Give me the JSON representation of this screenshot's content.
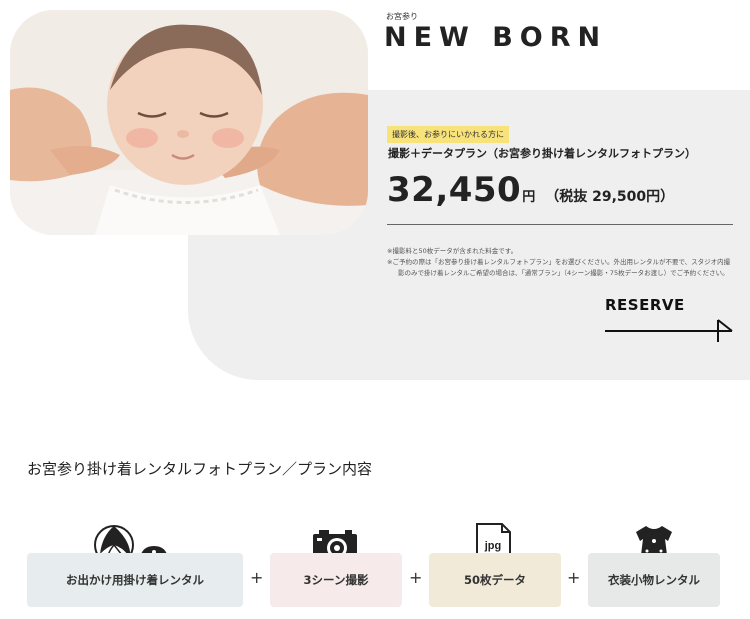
{
  "header": {
    "eyebrow": "お宮参り",
    "title": "NEW BORN"
  },
  "plan": {
    "tag": "撮影後、お参りにいかれる方に",
    "name": "撮影＋データプラン（お宮参り掛け着レンタルフォトプラン）",
    "price": "32,450",
    "yen": "円",
    "tax_note": "（税抜 29,500円）",
    "notes": [
      "※撮影料と50枚データが含まれた料金です。",
      "※ご予約の際は「お宮参り掛け着レンタルフォトプラン」をお選びください。外出用レンタルが不要で、スタジオ内撮影のみで掛け着レンタルご希望の場合は、「通常プラン」（4シーン撮影・75枚データお渡し）でご予約ください。"
    ]
  },
  "reserve": {
    "label": "RESERVE"
  },
  "contents": {
    "title": "お宮参り掛け着レンタルフォトプラン／プラン内容",
    "items": [
      {
        "label": "お出かけ用掛け着レンタル",
        "icon": "ball-and-hat-icon"
      },
      {
        "label": "3シーン撮影",
        "icon": "camera-icon"
      },
      {
        "label": "50枚データ",
        "icon": "jpg-file-icon"
      },
      {
        "label": "衣装小物レンタル",
        "icon": "baby-dress-icon"
      }
    ],
    "plus": "+",
    "file_ext": "jpg"
  }
}
